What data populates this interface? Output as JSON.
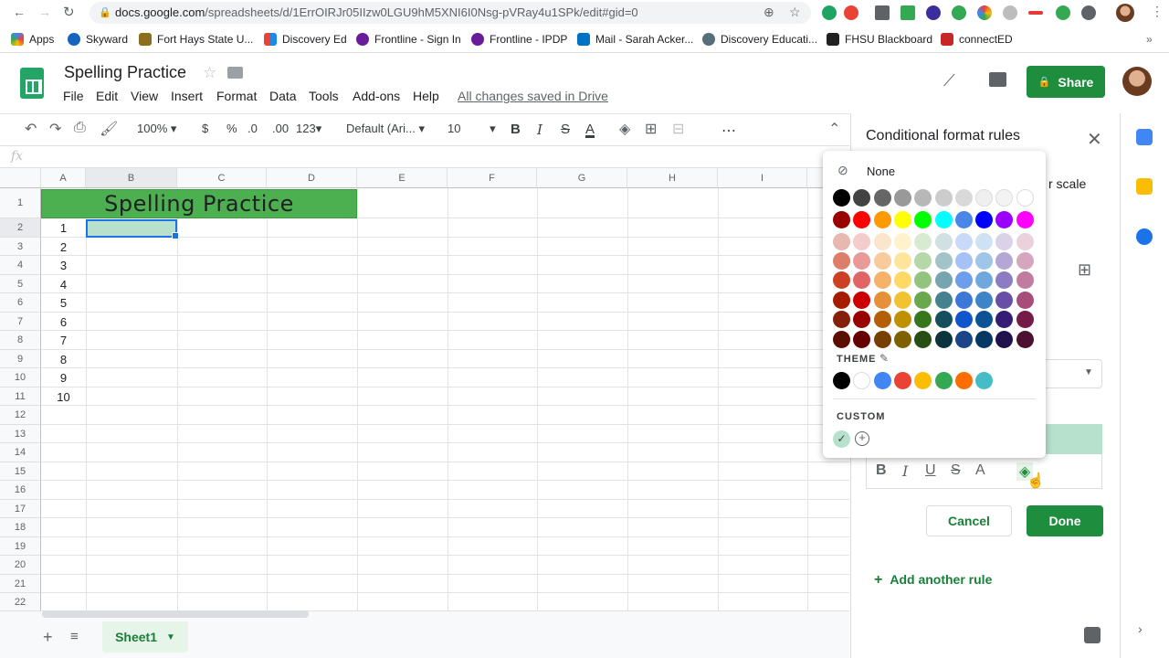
{
  "browser": {
    "url_host": "docs.google.com",
    "url_path": "/spreadsheets/d/1ErrOIRJr05IIzw0LGU9hM5XNI6I0Nsg-pVRay4u1SPk/edit#gid=0",
    "bookmarks": [
      "Apps",
      "Skyward",
      "Fort Hays State U...",
      "Discovery Ed",
      "Frontline - Sign In",
      "Frontline - IPDP",
      "Mail - Sarah Acker...",
      "Discovery Educati...",
      "FHSU Blackboard",
      "connectED"
    ]
  },
  "doc": {
    "title": "Spelling Practice",
    "menu": [
      "File",
      "Edit",
      "View",
      "Insert",
      "Format",
      "Data",
      "Tools",
      "Add-ons",
      "Help"
    ],
    "saved_status": "All changes saved in Drive",
    "share_label": "Share"
  },
  "toolbar": {
    "zoom": "100%",
    "currency": "$",
    "percent": "%",
    "dec_less": ".0",
    "dec_more": ".00",
    "more_formats": "123",
    "font": "Default (Ari...",
    "font_size": "10",
    "bold": "B",
    "italic": "I",
    "strike": "S",
    "text_color": "A",
    "more": "⋯"
  },
  "formula_bar": {
    "fx": "fx"
  },
  "grid": {
    "columns": [
      "A",
      "B",
      "C",
      "D",
      "E",
      "F",
      "G",
      "H",
      "I"
    ],
    "rows": [
      "1",
      "2",
      "3",
      "4",
      "5",
      "6",
      "7",
      "8",
      "9",
      "10",
      "11",
      "12",
      "13",
      "14",
      "15",
      "16",
      "17",
      "18",
      "19",
      "20",
      "21",
      "22"
    ],
    "title_cell": "Spelling Practice",
    "column_a_values": [
      "1",
      "2",
      "3",
      "4",
      "5",
      "6",
      "7",
      "8",
      "9",
      "10"
    ],
    "title_fill": "#4caf50",
    "selected_fill": "#b7e1cd"
  },
  "sheet_tab": {
    "label": "Sheet1"
  },
  "panel": {
    "title": "Conditional format rules",
    "partial_text": "r scale",
    "cancel_label": "Cancel",
    "done_label": "Done",
    "add_rule_label": "Add another rule",
    "format_buttons": [
      "B",
      "I",
      "U",
      "S",
      "A"
    ]
  },
  "color_picker": {
    "none_label": "None",
    "theme_label": "THEME",
    "custom_label": "CUSTOM",
    "grays": [
      "#000000",
      "#434343",
      "#666666",
      "#999999",
      "#b7b7b7",
      "#cccccc",
      "#d9d9d9",
      "#efefef",
      "#f3f3f3",
      "#ffffff"
    ],
    "palette": [
      [
        "#980000",
        "#ff0000",
        "#ff9900",
        "#ffff00",
        "#00ff00",
        "#00ffff",
        "#4a86e8",
        "#0000ff",
        "#9900ff",
        "#ff00ff"
      ],
      [
        "#e6b8af",
        "#f4cccc",
        "#fce5cd",
        "#fff2cc",
        "#d9ead3",
        "#d0e0e3",
        "#c9daf8",
        "#cfe2f3",
        "#d9d2e9",
        "#ead1dc"
      ],
      [
        "#dd7e6b",
        "#ea9999",
        "#f9cb9c",
        "#ffe599",
        "#b6d7a8",
        "#a2c4c9",
        "#a4c2f4",
        "#9fc5e8",
        "#b4a7d6",
        "#d5a6bd"
      ],
      [
        "#cc4125",
        "#e06666",
        "#f6b26b",
        "#ffd966",
        "#93c47d",
        "#76a5af",
        "#6d9eeb",
        "#6fa8dc",
        "#8e7cc3",
        "#c27ba0"
      ],
      [
        "#a61c00",
        "#cc0000",
        "#e69138",
        "#f1c232",
        "#6aa84f",
        "#45818e",
        "#3c78d8",
        "#3d85c6",
        "#674ea7",
        "#a64d79"
      ],
      [
        "#85200c",
        "#990000",
        "#b45f06",
        "#bf9000",
        "#38761d",
        "#134f5c",
        "#1155cc",
        "#0b5394",
        "#351c75",
        "#741b47"
      ],
      [
        "#5b0f00",
        "#660000",
        "#783f04",
        "#7f6000",
        "#274e13",
        "#0c343d",
        "#1c4587",
        "#073763",
        "#20124d",
        "#4c1130"
      ]
    ],
    "theme": [
      "#000000",
      "#ffffff",
      "#4285f4",
      "#ea4335",
      "#fbbc04",
      "#34a853",
      "#ff6d01",
      "#46bdc6"
    ],
    "custom": [
      "#b7e1cd"
    ]
  }
}
